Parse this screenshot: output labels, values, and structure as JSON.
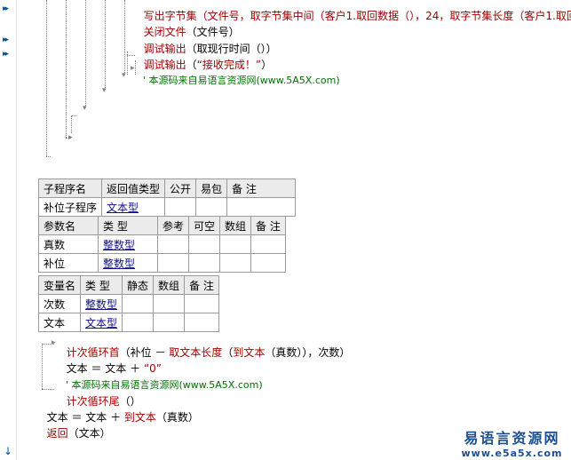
{
  "gutter": {
    "arrow_glyph": "▸▸",
    "down_glyph": "↓"
  },
  "top_code": {
    "line1": {
      "func": "写出字节集",
      "args": "（文件号，取字节集中间（客户1.取回数据（），24，取字节集长度（客户1.取回"
    },
    "line2": {
      "func": "关闭文件",
      "args": "（文件号）"
    },
    "line3": {
      "func": "调试输出",
      "args_open": "（取现行时间（））"
    },
    "line4": {
      "func": "调试输出",
      "paren_open": "（",
      "string": "“接收完成！”",
      "paren_close": "）"
    },
    "line5": {
      "comment": "' 本源码来自易语言资源网(www.5A5X.com)"
    }
  },
  "sub_table": {
    "headers": [
      "子程序名",
      "返回值类型",
      "公开",
      "易包",
      "备 注"
    ],
    "row": {
      "name": "补位子程序",
      "return_type": "文本型"
    },
    "param_headers": [
      "参数名",
      "类 型",
      "参考",
      "可空",
      "数组",
      "备 注"
    ],
    "params": [
      {
        "name": "真数",
        "type": "整数型"
      },
      {
        "name": "补位",
        "type": "整数型"
      }
    ]
  },
  "var_table": {
    "headers": [
      "变量名",
      "类 型",
      "静态",
      "数组",
      "备 注"
    ],
    "vars": [
      {
        "name": "次数",
        "type": "整数型"
      },
      {
        "name": "文本",
        "type": "文本型"
      }
    ]
  },
  "bottom_code": {
    "loop_head": {
      "func": "计次循环首",
      "args_a": "（补位 － ",
      "inner_func": "取文本长度",
      "args_b": "（",
      "inner_func2": "到文本",
      "args_c": "（真数）），次数）"
    },
    "body1": {
      "lhs": "文本 ＝ 文本 ＋ ",
      "string": "“0”"
    },
    "body2": {
      "comment": "' 本源码来自易语言资源网(www.5A5X.com)"
    },
    "loop_tail": {
      "func": "计次循环尾",
      "args": "（）"
    },
    "after1": {
      "lhs": "文本 ＝ 文本 ＋ ",
      "func": "到文本",
      "args": "（真数）"
    },
    "after2": {
      "func": "返回",
      "args": "（文本）"
    }
  },
  "watermark": {
    "title": "易语言资源网",
    "url": "www.e5a5x.com"
  }
}
